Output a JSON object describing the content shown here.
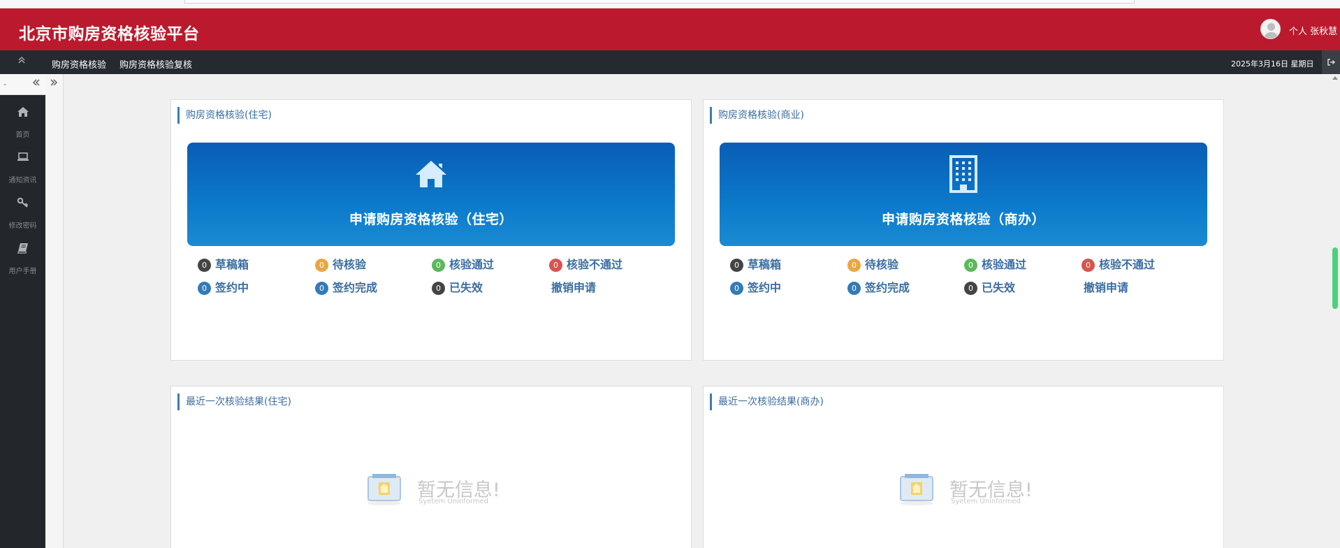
{
  "header": {
    "title": "北京市购房资格核验平台",
    "user": "个人 张秋慧"
  },
  "nav": {
    "items": [
      "购房资格核验",
      "购房资格核验复核"
    ],
    "date": "2025年3月16日 星期日"
  },
  "sidebar": {
    "top_text": "-",
    "items": [
      {
        "label": "首页",
        "icon": "home-icon"
      },
      {
        "label": "通知资讯",
        "icon": "laptop-icon"
      },
      {
        "label": "修改密码",
        "icon": "key-icon"
      },
      {
        "label": "用户手册",
        "icon": "book-icon"
      }
    ]
  },
  "panels": {
    "residential": {
      "title": "购房资格核验(住宅)",
      "apply_label": "申请购房资格核验（住宅）",
      "icon": "house-icon",
      "stats": [
        {
          "label": "草稿箱",
          "count": "0",
          "color": "#444444"
        },
        {
          "label": "待核验",
          "count": "0",
          "color": "#e9a741"
        },
        {
          "label": "核验通过",
          "count": "0",
          "color": "#5cb85c"
        },
        {
          "label": "核验不通过",
          "count": "0",
          "color": "#d9534f"
        },
        {
          "label": "签约中",
          "count": "0",
          "color": "#337ab7"
        },
        {
          "label": "签约完成",
          "count": "0",
          "color": "#337ab7"
        },
        {
          "label": "已失效",
          "count": "0",
          "color": "#444444"
        }
      ],
      "cancel_label": "撤销申请"
    },
    "commercial": {
      "title": "购房资格核验(商业)",
      "apply_label": "申请购房资格核验（商办）",
      "icon": "building-icon",
      "stats": [
        {
          "label": "草稿箱",
          "count": "0",
          "color": "#444444"
        },
        {
          "label": "待核验",
          "count": "0",
          "color": "#e9a741"
        },
        {
          "label": "核验通过",
          "count": "0",
          "color": "#5cb85c"
        },
        {
          "label": "核验不通过",
          "count": "0",
          "color": "#d9534f"
        },
        {
          "label": "签约中",
          "count": "0",
          "color": "#337ab7"
        },
        {
          "label": "签约完成",
          "count": "0",
          "color": "#337ab7"
        },
        {
          "label": "已失效",
          "count": "0",
          "color": "#444444"
        }
      ],
      "cancel_label": "撤销申请"
    },
    "last_residential": {
      "title": "最近一次核验结果(住宅)",
      "empty_msg": "暂无信息!",
      "empty_sub": "Syetem Uninformed"
    },
    "last_commercial": {
      "title": "最近一次核验结果(商办)",
      "empty_msg": "暂无信息!",
      "empty_sub": "Syetem Uninformed"
    }
  },
  "colors": {
    "header_red": "#bb1a2e",
    "navbar": "#252a30",
    "accent_blue": "#3a6da0"
  }
}
